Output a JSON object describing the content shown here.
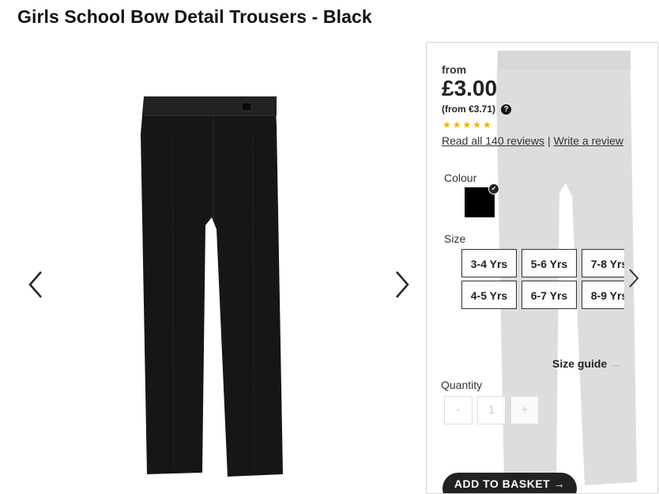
{
  "product": {
    "title": "Girls School Bow Detail Trousers - Black"
  },
  "pricing": {
    "from_label": "from",
    "price": "£3.00",
    "alt_price": "(from €3.71)",
    "help_glyph": "?"
  },
  "rating": {
    "stars_text": "★★★★★",
    "value": 4.5,
    "max": 5,
    "read_reviews": "Read all 140 reviews",
    "separator": "|",
    "write_review": "Write a review"
  },
  "colour": {
    "label": "Colour",
    "selected": "#000000"
  },
  "size": {
    "label": "Size",
    "options": [
      "3-4 Yrs",
      "5-6 Yrs",
      "7-8 Yrs",
      "4-5 Yrs",
      "6-7 Yrs",
      "8-9 Yrs"
    ]
  },
  "size_guide": {
    "label": "Size guide",
    "arrow": "→"
  },
  "quantity": {
    "label": "Quantity",
    "minus": "-",
    "value": "1",
    "plus": "+"
  },
  "basket": {
    "label": "ADD TO BASKET →"
  },
  "colors": {
    "star": "#f0b400",
    "button": "#222222"
  }
}
